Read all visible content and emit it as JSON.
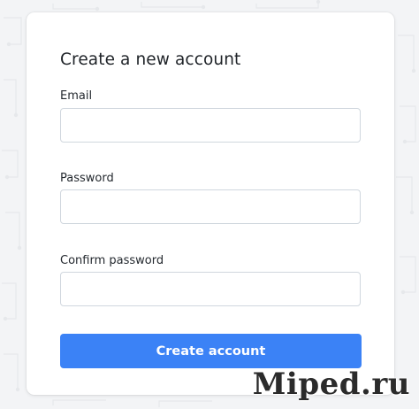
{
  "form": {
    "title": "Create a new account",
    "email_label": "Email",
    "email_value": "",
    "password_label": "Password",
    "password_value": "",
    "confirm_label": "Confirm password",
    "confirm_value": "",
    "submit_label": "Create account"
  },
  "watermark": "Miped.ru",
  "colors": {
    "accent": "#3b82f6",
    "background": "#f3f4f6",
    "card": "#ffffff",
    "input_border": "#d0d7de"
  }
}
